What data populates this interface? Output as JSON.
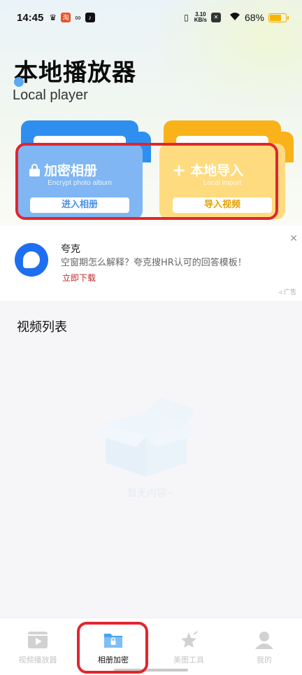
{
  "status_bar": {
    "time": "14:45",
    "speed_top": "3.10",
    "speed_bottom": "KB/s",
    "battery": "68%"
  },
  "header": {
    "title_zh": "本地播放器",
    "title_en": "Local player"
  },
  "cards": [
    {
      "title": "加密相册",
      "subtitle": "Encrypt photo album",
      "button": "进入相册",
      "icon": "lock-icon",
      "color": "#7fb6f3"
    },
    {
      "title": "本地导入",
      "subtitle": "Local import",
      "button": "导入视频",
      "icon": "plus-icon",
      "color": "#ffdb7f"
    }
  ],
  "ad": {
    "name": "夸克",
    "description": "空窗期怎么解释？夸克搜HR认可的回答模板！",
    "download": "立即下载",
    "tag": "广告"
  },
  "video_list": {
    "title": "视频列表",
    "empty_text": "暂无内容~"
  },
  "nav": {
    "items": [
      {
        "label": "视频播放器",
        "icon": "video-player-icon",
        "active": false
      },
      {
        "label": "相册加密",
        "icon": "folder-lock-icon",
        "active": true
      },
      {
        "label": "美图工具",
        "icon": "magic-wand-icon",
        "active": false
      },
      {
        "label": "我的",
        "icon": "user-icon",
        "active": false
      }
    ]
  },
  "colors": {
    "accent_red": "#e0262e",
    "blue": "#2f8ff0",
    "yellow": "#f9b21a"
  }
}
